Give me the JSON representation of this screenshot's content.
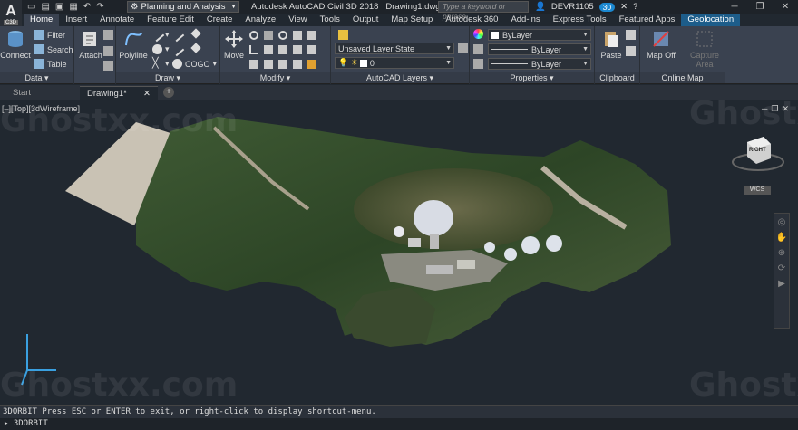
{
  "app": {
    "logo_letter": "A",
    "logo_sub": "C3D",
    "workspace": "Planning and Analysis",
    "title": "Autodesk AutoCAD Civil 3D 2018",
    "filename": "Drawing1.dwg",
    "search_placeholder": "Type a keyword or phrase",
    "user": "DEVR1105",
    "badge": "30",
    "help": "?"
  },
  "ribbon_tabs": [
    "Home",
    "Insert",
    "Annotate",
    "Feature Edit",
    "Create",
    "Analyze",
    "View",
    "Tools",
    "Output",
    "Map Setup",
    "Autodesk 360",
    "Add-ins",
    "Express Tools",
    "Featured Apps",
    "Geolocation"
  ],
  "panels": {
    "data": {
      "title": "Data ▾",
      "connect": "Connect",
      "filter": "Filter",
      "search": "Search",
      "table": "Table",
      "attach": "Attach"
    },
    "draw": {
      "title": "Draw ▾",
      "polyline": "Polyline",
      "cogo": "COGO"
    },
    "modify": {
      "title": "Modify ▾",
      "move": "Move"
    },
    "layers": {
      "title": "AutoCAD Layers ▾",
      "layer_state": "Unsaved Layer State",
      "current_layer": "0"
    },
    "properties": {
      "title": "Properties ▾",
      "color": "ByLayer",
      "linetype": "ByLayer",
      "lineweight": "ByLayer"
    },
    "clipboard": {
      "title": "Clipboard",
      "paste": "Paste"
    },
    "online_map": {
      "title": "Online Map",
      "map_off": "Map Off",
      "capture": "Capture Area"
    }
  },
  "doc_tabs": {
    "start": "Start",
    "drawing": "Drawing1*"
  },
  "viewport": {
    "label": "[–][Top][3dWireframe]",
    "viewcube_face": "RIGHT",
    "wcs": "WCS"
  },
  "command": {
    "history": "3DORBIT Press ESC or ENTER to exit, or right-click to display shortcut-menu.",
    "prompt": "3DORBIT"
  },
  "watermark": "Ghostxx.com",
  "colors": {
    "ribbon_bg": "#3a4250",
    "geolocation_tab": "#1d5d8a",
    "viewport_bg": "#212830"
  }
}
